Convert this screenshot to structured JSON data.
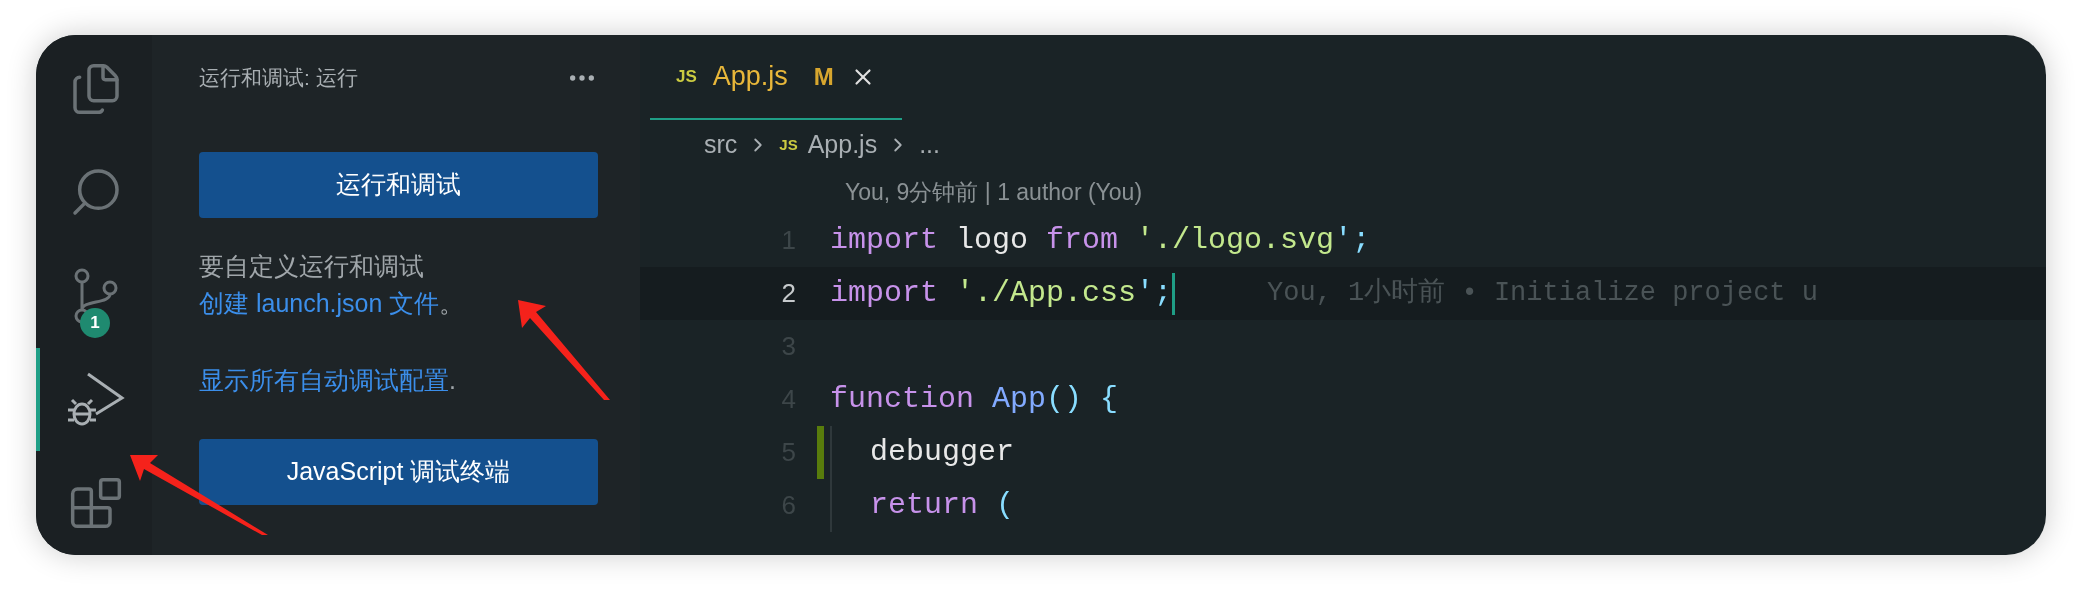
{
  "activity_bar": {
    "items": [
      {
        "kind": "files",
        "selected": false
      },
      {
        "kind": "search",
        "selected": false
      },
      {
        "kind": "source-control",
        "selected": false,
        "badge": "1"
      },
      {
        "kind": "run-debug",
        "selected": true
      },
      {
        "kind": "extensions",
        "selected": false
      }
    ]
  },
  "sidebar": {
    "title": "运行和调试: 运行",
    "content": [
      {
        "kind": "button",
        "label": "运行和调试"
      },
      {
        "kind": "paragraph",
        "text": "要自定义运行和调试",
        "link": "创建 launch.json 文件",
        "after": "。"
      },
      {
        "kind": "paragraph",
        "link": "显示所有自动调试配置",
        "after": "."
      },
      {
        "kind": "button",
        "label": "JavaScript 调试终端"
      }
    ]
  },
  "editor": {
    "tabs": [
      {
        "label": "App.js",
        "file_badge": "JS",
        "status": "M",
        "selected": true
      }
    ],
    "breadcrumb": [
      {
        "label": "src"
      },
      {
        "label": "App.js",
        "file_badge": "JS"
      },
      {
        "label": "..."
      }
    ],
    "codelens": "You, 9分钟前 | 1 author (You)",
    "lines": [
      {
        "number": "1",
        "current": false,
        "added": false,
        "tokens": [
          {
            "kind": "keyword",
            "text": "import"
          },
          {
            "kind": "plain",
            "text": " logo "
          },
          {
            "kind": "keyword",
            "text": "from"
          },
          {
            "kind": "string",
            "text": " './logo.svg"
          },
          {
            "kind": "punct",
            "text": "';"
          }
        ]
      },
      {
        "number": "2",
        "current": true,
        "added": false,
        "blame": "You, 1小时前 • Initialize project u",
        "tokens": [
          {
            "kind": "keyword",
            "text": "import"
          },
          {
            "kind": "string",
            "text": " './App.css"
          },
          {
            "kind": "punct",
            "text": "';"
          }
        ]
      },
      {
        "number": "3",
        "current": false,
        "added": false
      },
      {
        "number": "4",
        "current": false,
        "added": false,
        "tokens": [
          {
            "kind": "keyword",
            "text": "function"
          },
          {
            "kind": "function",
            "text": " App"
          },
          {
            "kind": "punct",
            "text": "() {"
          }
        ],
        "children": [
          {
            "number": "5",
            "current": false,
            "added": true,
            "tokens": [
              {
                "kind": "plain",
                "text": "debugger"
              }
            ]
          },
          {
            "number": "6",
            "current": false,
            "added": false,
            "tokens": [
              {
                "kind": "keyword",
                "text": "return"
              },
              {
                "kind": "punct",
                "text": " ("
              }
            ]
          }
        ]
      }
    ]
  }
}
